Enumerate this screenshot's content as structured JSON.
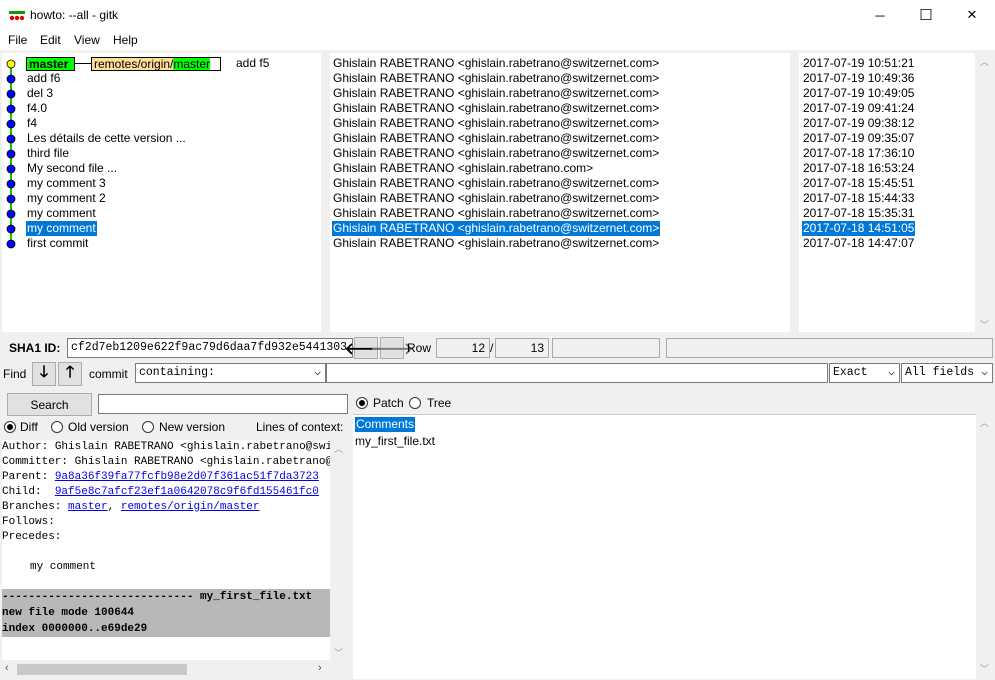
{
  "window": {
    "title": "howto: --all - gitk",
    "minimize": "─",
    "maximize": "☐",
    "close": "✕"
  },
  "menu": [
    "File",
    "Edit",
    "View",
    "Help"
  ],
  "refs": {
    "head": "master",
    "remote_prefix": "remotes/origin/",
    "remote_branch": "master"
  },
  "commits": [
    {
      "message": "add f5",
      "author": "Ghislain RABETRANO <ghislain.rabetrano@switzernet.com>",
      "date": "2017-07-19 10:51:21"
    },
    {
      "message": "add f6",
      "author": "Ghislain RABETRANO <ghislain.rabetrano@switzernet.com>",
      "date": "2017-07-19 10:49:36"
    },
    {
      "message": "del 3",
      "author": "Ghislain RABETRANO <ghislain.rabetrano@switzernet.com>",
      "date": "2017-07-19 10:49:05"
    },
    {
      "message": "f4.0",
      "author": "Ghislain RABETRANO <ghislain.rabetrano@switzernet.com>",
      "date": "2017-07-19 09:41:24"
    },
    {
      "message": "f4",
      "author": "Ghislain RABETRANO <ghislain.rabetrano@switzernet.com>",
      "date": "2017-07-19 09:38:12"
    },
    {
      "message": "Les détails de cette version ...",
      "author": "Ghislain RABETRANO <ghislain.rabetrano@switzernet.com>",
      "date": "2017-07-19 09:35:07"
    },
    {
      "message": "third file",
      "author": "Ghislain RABETRANO <ghislain.rabetrano@switzernet.com>",
      "date": "2017-07-18 17:36:10"
    },
    {
      "message": "My second file ...",
      "author": "Ghislain RABETRANO <ghislain.rabetrano.com>",
      "date": "2017-07-18 16:53:24"
    },
    {
      "message": "my comment 3",
      "author": "Ghislain RABETRANO <ghislain.rabetrano@switzernet.com>",
      "date": "2017-07-18 15:45:51"
    },
    {
      "message": "my comment 2",
      "author": "Ghislain RABETRANO <ghislain.rabetrano@switzernet.com>",
      "date": "2017-07-18 15:44:33"
    },
    {
      "message": "my comment",
      "author": "Ghislain RABETRANO <ghislain.rabetrano@switzernet.com>",
      "date": "2017-07-18 15:35:31"
    },
    {
      "message": "my comment",
      "author": "Ghislain RABETRANO <ghislain.rabetrano@switzernet.com>",
      "date": "2017-07-18 14:51:05"
    },
    {
      "message": "first commit",
      "author": "Ghislain RABETRANO <ghislain.rabetrano@switzernet.com>",
      "date": "2017-07-18 14:47:07"
    }
  ],
  "selected_row": 11,
  "sha1": {
    "label": "SHA1 ID:",
    "value": "cf2d7eb1209e622f9ac79d6daa7fd932e5441303"
  },
  "row_info": {
    "label": "Row",
    "current": "12",
    "separator": "/",
    "total": "13"
  },
  "find": {
    "label": "Find",
    "commit_label": "commit",
    "mode": "containing:",
    "match": "Exact",
    "fields": "All fields"
  },
  "search": {
    "button": "Search"
  },
  "diff_options": {
    "diff": "Diff",
    "old": "Old version",
    "new": "New version",
    "context_label": "Lines of context:"
  },
  "patch_tree": {
    "patch": "Patch",
    "tree": "Tree"
  },
  "details": {
    "author_label": "Author:",
    "author": "Ghislain RABETRANO <ghislain.rabetrano@switzernet.com>",
    "committer_label": "Committer:",
    "committer": "Ghislain RABETRANO <ghislain.rabetrano@switzernet.com>",
    "parent_label": "Parent:",
    "parent": "9a8a36f39fa77fcfb98e2d07f361ac51f7da3723",
    "child_label": "Child:",
    "child": "9af5e8c7afcf23ef1a0642078c9f6fd155461fc0",
    "branches_label": "Branches:",
    "branch1": "master",
    "branch_sep": ",",
    "branch2": "remotes/origin/master",
    "follows_label": "Follows:",
    "precedes_label": "Precedes:",
    "message": "my comment",
    "file_header": "----------------------------- my_first_file.txt",
    "file_mode": "new file mode 100644",
    "index": "index 0000000..e69de29"
  },
  "files": {
    "comments": "Comments",
    "file1": "my_first_file.txt"
  },
  "colors": {
    "selection": "#0078d7",
    "head_ref": "#00ff00",
    "remote_ref": "#ffdd99",
    "graph_node": "#0000ff",
    "head_node": "#ffff00",
    "graph_line": "#00cc00"
  }
}
